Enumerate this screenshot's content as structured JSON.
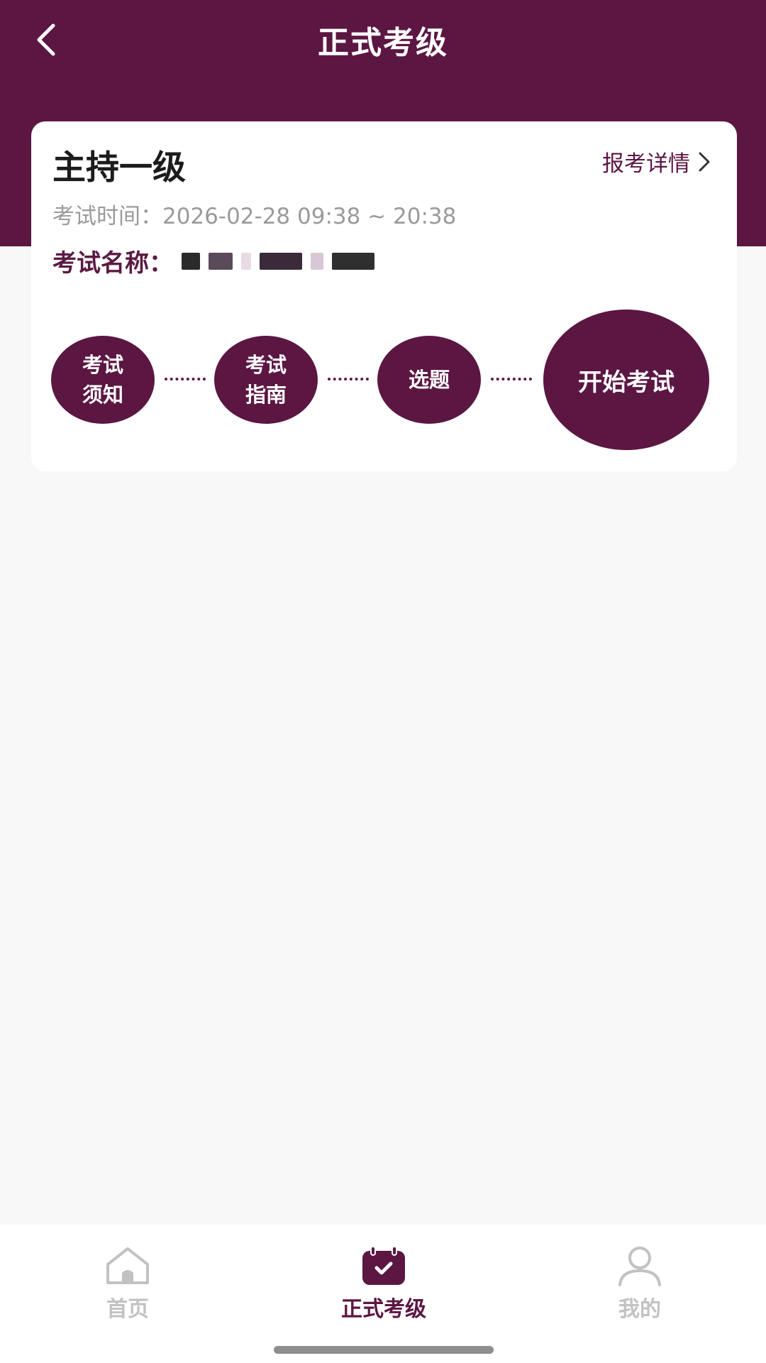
{
  "theme": {
    "brand": "#5c1642",
    "inactive": "#c2c2c2"
  },
  "header": {
    "title": "正式考级",
    "back_icon": "chevron-left-icon"
  },
  "card": {
    "level": "主持一级",
    "detail_link": "报考详情",
    "detail_icon": "chevron-right-icon",
    "time_label": "考试时间：",
    "time_value": "2026-02-28 09:38 ~ 20:38",
    "name_label": "考试名称："
  },
  "steps": [
    {
      "line1": "考试",
      "line2": "须知"
    },
    {
      "line1": "考试",
      "line2": "指南"
    },
    {
      "label": "选题"
    },
    {
      "label": "开始考试"
    }
  ],
  "bottom_nav": [
    {
      "label": "首页",
      "icon": "home-icon",
      "active": false
    },
    {
      "label": "正式考级",
      "icon": "calendar-check-icon",
      "active": true
    },
    {
      "label": "我的",
      "icon": "user-icon",
      "active": false
    }
  ]
}
